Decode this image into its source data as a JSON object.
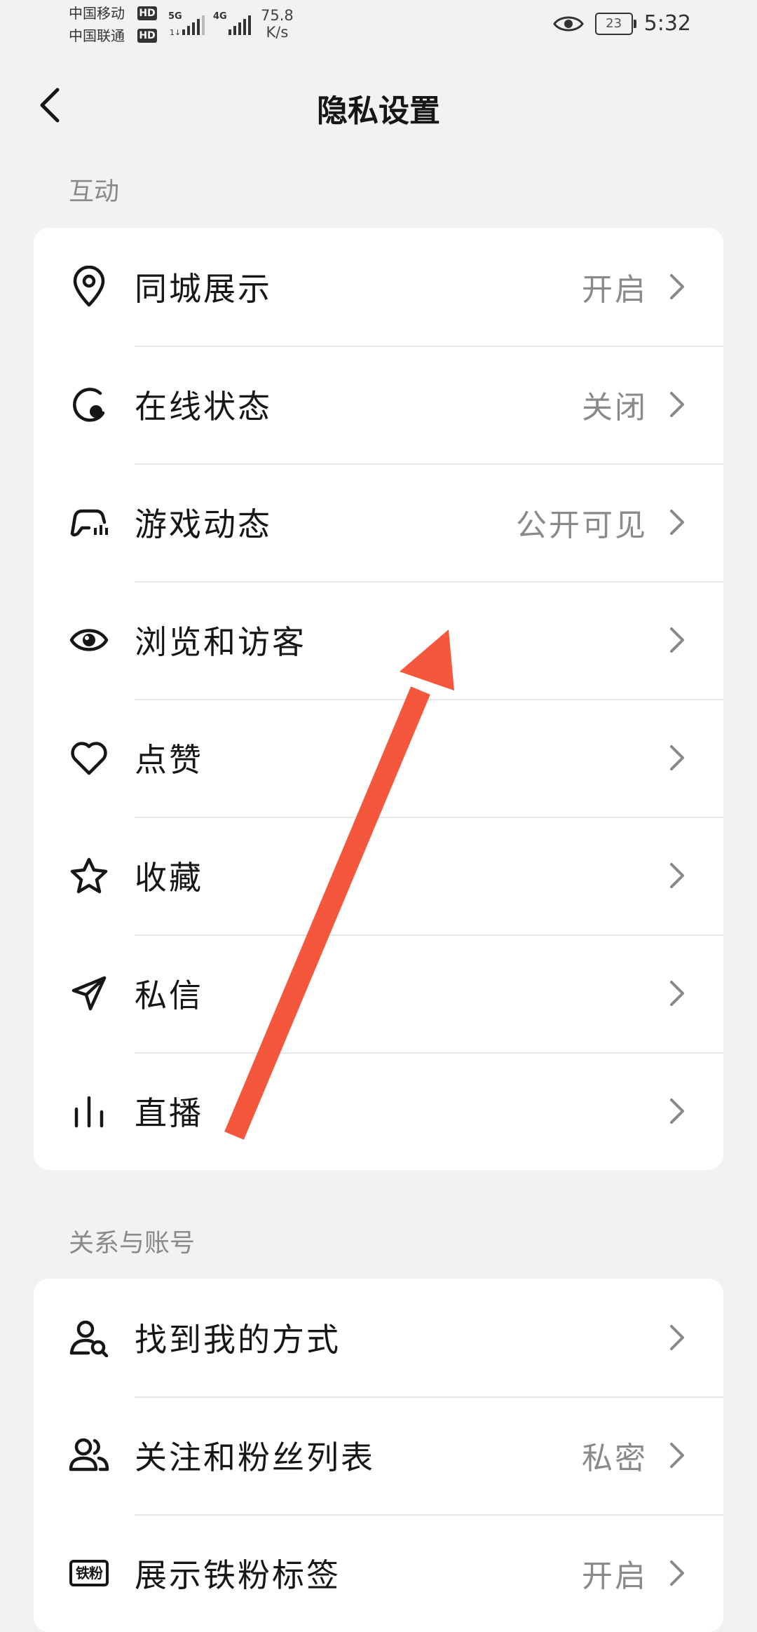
{
  "status_bar": {
    "carrier1": "中国移动",
    "carrier2": "中国联通",
    "hd": "HD",
    "net1": "5G",
    "net2": "4G",
    "speed_value": "75.8",
    "speed_unit": "K/s",
    "battery": "23",
    "time": "5:32"
  },
  "header": {
    "title": "隐私设置"
  },
  "sections": [
    {
      "title": "互动",
      "items": [
        {
          "icon": "location-pin-icon",
          "label": "同城展示",
          "value": "开启"
        },
        {
          "icon": "online-status-icon",
          "label": "在线状态",
          "value": "关闭"
        },
        {
          "icon": "game-controller-icon",
          "label": "游戏动态",
          "value": "公开可见"
        },
        {
          "icon": "eye-icon",
          "label": "浏览和访客",
          "value": ""
        },
        {
          "icon": "heart-icon",
          "label": "点赞",
          "value": ""
        },
        {
          "icon": "star-icon",
          "label": "收藏",
          "value": ""
        },
        {
          "icon": "send-icon",
          "label": "私信",
          "value": ""
        },
        {
          "icon": "live-bars-icon",
          "label": "直播",
          "value": ""
        }
      ]
    },
    {
      "title": "关系与账号",
      "items": [
        {
          "icon": "user-search-icon",
          "label": "找到我的方式",
          "value": ""
        },
        {
          "icon": "users-icon",
          "label": "关注和粉丝列表",
          "value": "私密"
        },
        {
          "icon": "fan-badge-icon",
          "badge_text": "铁粉",
          "label": "展示铁粉标签",
          "value": "开启"
        }
      ]
    }
  ],
  "colors": {
    "arrow": "#f5573d",
    "background": "#f2f2f2",
    "card": "#ffffff",
    "muted": "#8a8a8a"
  }
}
